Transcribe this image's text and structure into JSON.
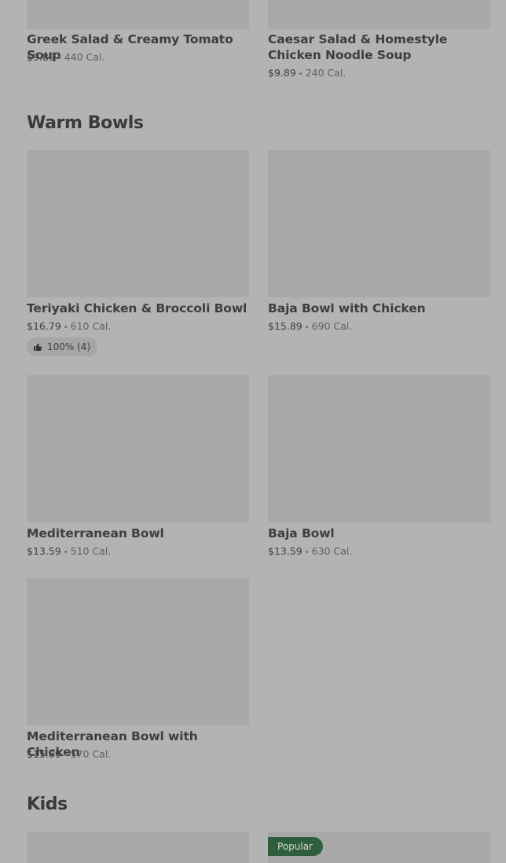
{
  "sections": {
    "warm_bowls_title": "Warm Bowls",
    "kids_title": "Kids"
  },
  "items": [
    {
      "name": "Greek Salad & Creamy Tomato Soup",
      "price": "$9.89",
      "calories": "440 Cal."
    },
    {
      "name": "Caesar Salad & Homestyle Chicken Noodle Soup",
      "price": "$9.89",
      "calories": "240 Cal."
    },
    {
      "name": "Teriyaki Chicken & Broccoli Bowl",
      "price": "$16.79",
      "calories": "610 Cal.",
      "rating": "100% (4)"
    },
    {
      "name": "Baja Bowl with Chicken",
      "price": "$15.89",
      "calories": "690 Cal."
    },
    {
      "name": "Mediterranean Bowl",
      "price": "$13.59",
      "calories": "510 Cal."
    },
    {
      "name": "Baja Bowl",
      "price": "$13.59",
      "calories": "630 Cal."
    },
    {
      "name": "Mediterranean Bowl with Chicken",
      "price": "$15.89",
      "calories": "570 Cal."
    }
  ],
  "kids": {
    "popular_badge": "Popular"
  },
  "separator": "•",
  "icons": {
    "rating": "thumbs-up-icon"
  }
}
